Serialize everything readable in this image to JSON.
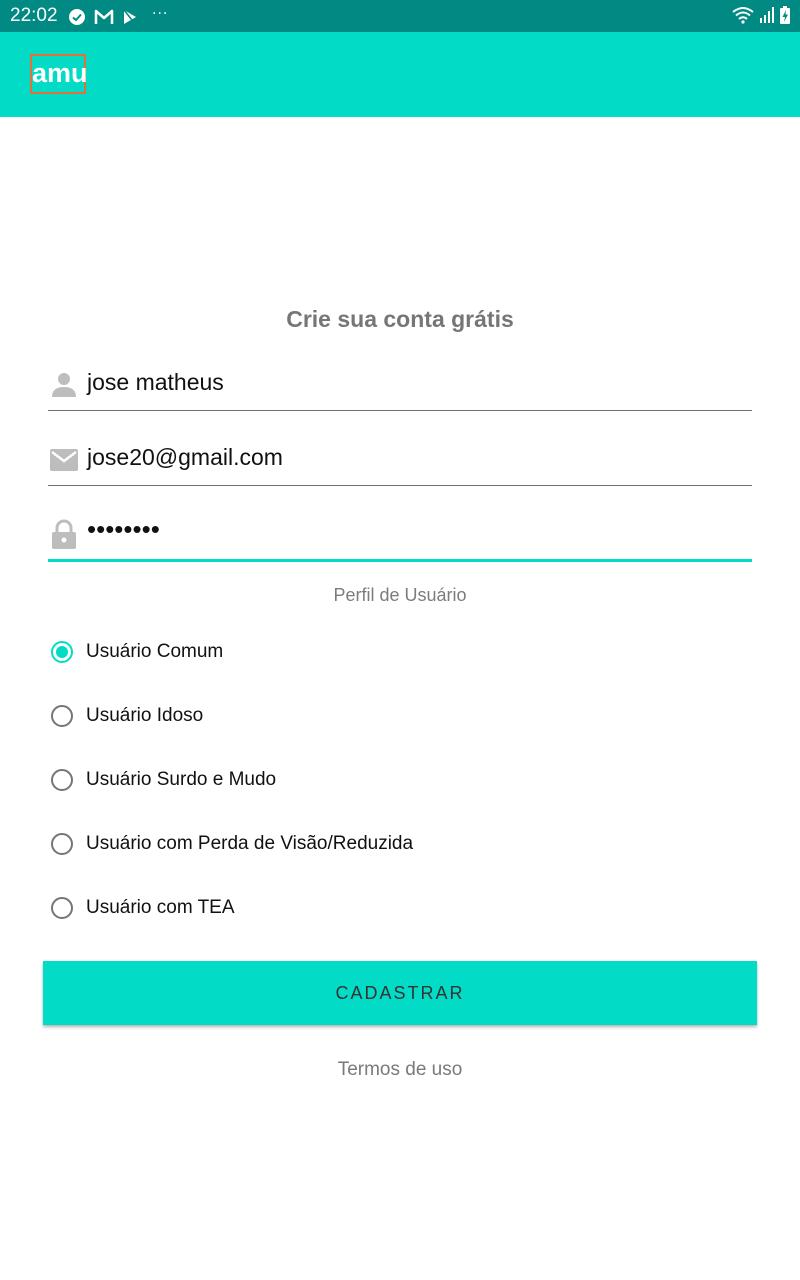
{
  "status_bar": {
    "time": "22:02",
    "left_icons": [
      "check-circle-icon",
      "gmail-icon",
      "play-store-icon"
    ],
    "overflow": "···",
    "right_icons": [
      "wifi-icon",
      "signal-icon",
      "battery-charging-icon"
    ]
  },
  "app_bar": {
    "logo_text": "amu",
    "color": "#02dcc7",
    "logo_border_color": "#e2703a"
  },
  "form": {
    "heading": "Crie sua conta grátis",
    "name": {
      "value": "jose matheus",
      "icon": "person-icon"
    },
    "email": {
      "value": "jose20@gmail.com",
      "icon": "email-icon"
    },
    "password": {
      "value": "••••••••",
      "icon": "lock-icon"
    }
  },
  "profile": {
    "label": "Perfil de Usuário",
    "options": [
      {
        "label": "Usuário Comum",
        "selected": true
      },
      {
        "label": "Usuário Idoso",
        "selected": false
      },
      {
        "label": "Usuário Surdo e Mudo",
        "selected": false
      },
      {
        "label": "Usuário com Perda de Visão/Reduzida",
        "selected": false
      },
      {
        "label": "Usuário com TEA",
        "selected": false
      }
    ]
  },
  "submit_label": "CADASTRAR",
  "terms_label": "Termos de uso",
  "colors": {
    "accent": "#02dcc7",
    "status_bar": "#008a83"
  }
}
